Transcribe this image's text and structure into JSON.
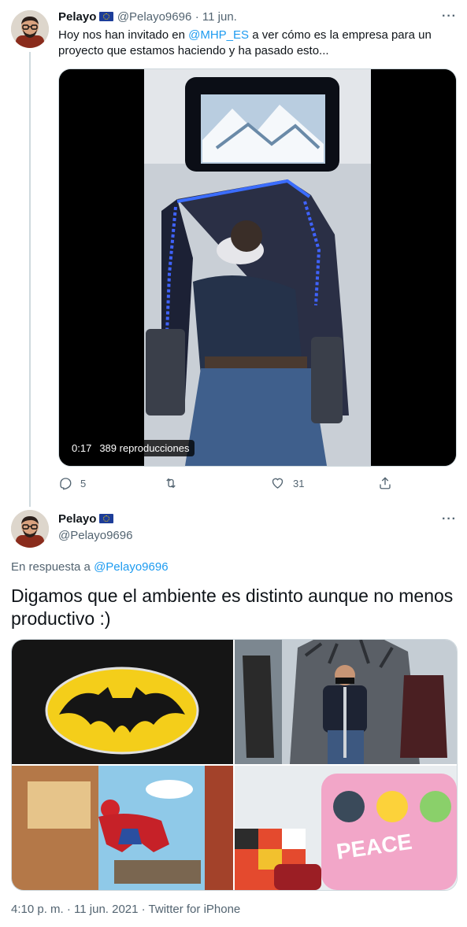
{
  "tweet1": {
    "name": "Pelayo",
    "handle": "@Pelayo9696",
    "date": "· 11 jun.",
    "text_pre": "Hoy nos han invitado en ",
    "mention": "@MHP_ES",
    "text_post": " a ver cómo es la empresa para un proyecto que estamos haciendo y ha pasado esto...",
    "video": {
      "time": "0:17",
      "views": "389 reproducciones"
    },
    "actions": {
      "replies": "5",
      "retweets": "",
      "likes": "31"
    }
  },
  "tweet2": {
    "name": "Pelayo",
    "handle": "@Pelayo9696",
    "reply_prefix": "En respuesta a ",
    "reply_to": "@Pelayo9696",
    "text": "Digamos que el ambiente es distinto aunque no menos productivo :)",
    "footer": "4:10 p. m. · 11 jun. 2021 · Twitter for iPhone"
  },
  "colors": {
    "accent": "#1d9bf0",
    "muted": "#536471",
    "border": "#cfd9de"
  },
  "icons": [
    "more-icon",
    "reply-icon",
    "retweet-icon",
    "like-icon",
    "share-icon",
    "eu-flag-icon"
  ]
}
